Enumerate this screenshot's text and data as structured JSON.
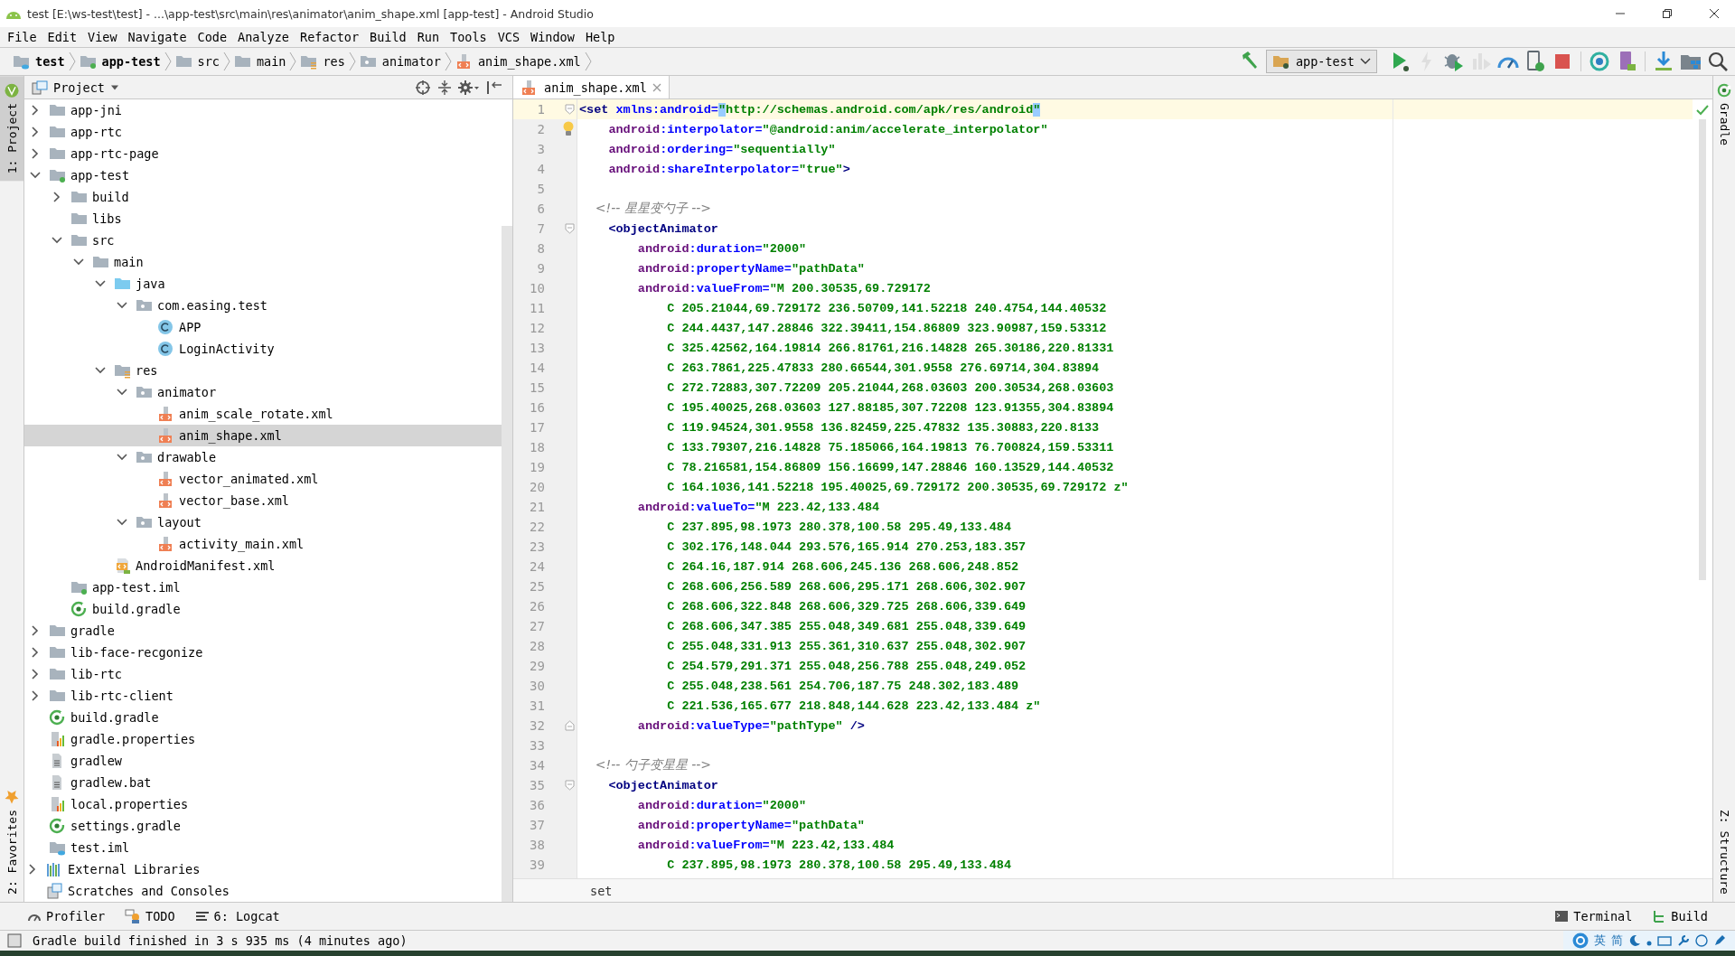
{
  "window": {
    "title": "test [E:\\ws-test\\test] - ...\\app-test\\src\\main\\res\\animator\\anim_shape.xml [app-test] - Android Studio"
  },
  "menu": [
    "File",
    "Edit",
    "View",
    "Navigate",
    "Code",
    "Analyze",
    "Refactor",
    "Build",
    "Run",
    "Tools",
    "VCS",
    "Window",
    "Help"
  ],
  "breadcrumbs": [
    {
      "kind": "project",
      "label": "test"
    },
    {
      "kind": "module",
      "label": "app-test"
    },
    {
      "kind": "folder",
      "label": "src"
    },
    {
      "kind": "folder",
      "label": "main"
    },
    {
      "kind": "res",
      "label": "res"
    },
    {
      "kind": "package",
      "label": "animator"
    },
    {
      "kind": "xml",
      "label": "anim_shape.xml"
    }
  ],
  "toolbar": [
    {
      "kind": "hammer",
      "disabled": false
    },
    {
      "kind": "run-config",
      "label": "app-test",
      "disabled": false
    },
    {
      "kind": "run",
      "disabled": false
    },
    {
      "kind": "lightning",
      "disabled": true
    },
    {
      "kind": "debug",
      "disabled": false
    },
    {
      "kind": "attach",
      "disabled": true
    },
    {
      "kind": "profile",
      "disabled": false
    },
    {
      "kind": "device-debug",
      "disabled": false
    },
    {
      "kind": "stop",
      "disabled": false
    },
    {
      "kind": "sync",
      "disabled": false
    },
    {
      "kind": "avd",
      "disabled": false
    },
    {
      "kind": "sdk",
      "disabled": false
    },
    {
      "kind": "structure",
      "disabled": false
    },
    {
      "kind": "search",
      "disabled": false
    }
  ],
  "left_stripe": {
    "top": [
      {
        "label": "1: Project",
        "selected": true
      }
    ],
    "bottom": [
      {
        "label": "2: Favorites",
        "selected": false
      }
    ]
  },
  "right_stripe": {
    "top": [
      {
        "label": "Gradle",
        "selected": false
      }
    ],
    "bottom": [
      {
        "label": "Z: Structure",
        "selected": false
      }
    ]
  },
  "project_panel": {
    "title": "Project",
    "tree": [
      {
        "children": [
          {
            "name": "app-jni",
            "kind": "folder",
            "expanded": false,
            "selected": false
          },
          {
            "name": "app-rtc",
            "kind": "folder",
            "expanded": false,
            "selected": false
          },
          {
            "name": "app-rtc-page",
            "kind": "folder",
            "expanded": false,
            "selected": false
          },
          {
            "name": "app-test",
            "kind": "module",
            "expanded": true,
            "selected": false,
            "children": [
              {
                "name": "build",
                "kind": "folder",
                "expanded": false,
                "selected": false
              },
              {
                "name": "libs",
                "kind": "folder",
                "selected": false
              },
              {
                "name": "src",
                "kind": "folder",
                "expanded": true,
                "selected": false,
                "children": [
                  {
                    "name": "main",
                    "kind": "folder",
                    "expanded": true,
                    "selected": false,
                    "children": [
                      {
                        "name": "java",
                        "kind": "source",
                        "expanded": true,
                        "selected": false,
                        "children": [
                          {
                            "name": "com.easing.test",
                            "kind": "package",
                            "expanded": true,
                            "selected": false,
                            "children": [
                              {
                                "name": "APP",
                                "kind": "class",
                                "selected": false
                              },
                              {
                                "name": "LoginActivity",
                                "kind": "class",
                                "selected": false
                              }
                            ]
                          }
                        ]
                      },
                      {
                        "name": "res",
                        "kind": "res",
                        "expanded": true,
                        "selected": false,
                        "children": [
                          {
                            "name": "animator",
                            "kind": "package",
                            "expanded": true,
                            "selected": false,
                            "children": [
                              {
                                "name": "anim_scale_rotate.xml",
                                "kind": "xml",
                                "selected": false
                              },
                              {
                                "name": "anim_shape.xml",
                                "kind": "xml",
                                "selected": true
                              }
                            ]
                          },
                          {
                            "name": "drawable",
                            "kind": "package",
                            "expanded": true,
                            "selected": false,
                            "children": [
                              {
                                "name": "vector_animated.xml",
                                "kind": "xml",
                                "selected": false
                              },
                              {
                                "name": "vector_base.xml",
                                "kind": "xml",
                                "selected": false
                              }
                            ]
                          },
                          {
                            "name": "layout",
                            "kind": "package",
                            "expanded": true,
                            "selected": false,
                            "children": [
                              {
                                "name": "activity_main.xml",
                                "kind": "xml",
                                "selected": false
                              }
                            ]
                          }
                        ]
                      },
                      {
                        "name": "AndroidManifest.xml",
                        "kind": "manifest",
                        "selected": false
                      }
                    ]
                  }
                ]
              },
              {
                "name": "app-test.iml",
                "kind": "module",
                "selected": false
              },
              {
                "name": "build.gradle",
                "kind": "gradle",
                "selected": false
              }
            ]
          },
          {
            "name": "gradle",
            "kind": "folder",
            "expanded": false,
            "selected": false
          },
          {
            "name": "lib-face-recgonize",
            "kind": "folder",
            "expanded": false,
            "selected": false
          },
          {
            "name": "lib-rtc",
            "kind": "folder",
            "expanded": false,
            "selected": false
          },
          {
            "name": "lib-rtc-client",
            "kind": "folder",
            "expanded": false,
            "selected": false
          },
          {
            "name": "build.gradle",
            "kind": "gradle",
            "selected": false
          },
          {
            "name": "gradle.properties",
            "kind": "properties",
            "selected": false
          },
          {
            "name": "gradlew",
            "kind": "text",
            "selected": false
          },
          {
            "name": "gradlew.bat",
            "kind": "text",
            "selected": false
          },
          {
            "name": "local.properties",
            "kind": "properties",
            "selected": false
          },
          {
            "name": "settings.gradle",
            "kind": "gradle",
            "selected": false
          },
          {
            "name": "test.iml",
            "kind": "project",
            "selected": false
          }
        ]
      },
      {
        "name": "External Libraries",
        "kind": "libraries",
        "expanded": false,
        "selected": false
      },
      {
        "name": "Scratches and Consoles",
        "kind": "scratches",
        "selected": false
      }
    ]
  },
  "editor": {
    "tab": {
      "label": "anim_shape.xml",
      "selected": true
    },
    "lines": [
      {
        "number": "1",
        "current": true,
        "kind": "fold-open",
        "tokens": [
          {
            "kind": "tag",
            "text": "<set"
          },
          {
            "kind": "attr",
            "text": " xmlns:android="
          },
          {
            "kind": "match",
            "text": "\""
          },
          {
            "kind": "val",
            "text": "http://schemas.android.com/apk/res/android"
          },
          {
            "kind": "match",
            "text": "\""
          }
        ]
      },
      {
        "number": "2",
        "current": false,
        "kind": "bulb",
        "tokens": [
          {
            "kind": "ns",
            "text": "    android"
          },
          {
            "kind": "attr",
            "text": ":interpolator="
          },
          {
            "kind": "val",
            "text": "\"@android:anim/accelerate_interpolator\""
          }
        ]
      },
      {
        "number": "3",
        "current": false,
        "tokens": [
          {
            "kind": "ns",
            "text": "    android"
          },
          {
            "kind": "attr",
            "text": ":ordering="
          },
          {
            "kind": "val",
            "text": "\"sequentially\""
          }
        ]
      },
      {
        "number": "4",
        "current": false,
        "tokens": [
          {
            "kind": "ns",
            "text": "    android"
          },
          {
            "kind": "attr",
            "text": ":shareInterpolator="
          },
          {
            "kind": "val",
            "text": "\"true\""
          },
          {
            "kind": "tag",
            "text": ">"
          }
        ]
      },
      {
        "number": "5",
        "current": false
      },
      {
        "number": "6",
        "current": false,
        "tokens": [
          {
            "kind": "comment",
            "text": "    <!-- 星星变勺子 -->"
          }
        ]
      },
      {
        "number": "7",
        "current": false,
        "kind": "fold-open",
        "tokens": [
          {
            "kind": "tag",
            "text": "    <objectAnimator"
          }
        ]
      },
      {
        "number": "8",
        "current": false,
        "tokens": [
          {
            "kind": "ns",
            "text": "        android"
          },
          {
            "kind": "attr",
            "text": ":duration="
          },
          {
            "kind": "val",
            "text": "\"2000\""
          }
        ]
      },
      {
        "number": "9",
        "current": false,
        "tokens": [
          {
            "kind": "ns",
            "text": "        android"
          },
          {
            "kind": "attr",
            "text": ":propertyName="
          },
          {
            "kind": "val",
            "text": "\"pathData\""
          }
        ]
      },
      {
        "number": "10",
        "current": false,
        "tokens": [
          {
            "kind": "ns",
            "text": "        android"
          },
          {
            "kind": "attr",
            "text": ":valueFrom="
          },
          {
            "kind": "val",
            "text": "\"M 200.30535,69.729172"
          }
        ]
      },
      {
        "number": "11",
        "current": false,
        "tokens": [
          {
            "kind": "val",
            "text": "            C 205.21044,69.729172 236.50709,141.52218 240.4754,144.40532"
          }
        ]
      },
      {
        "number": "12",
        "current": false,
        "tokens": [
          {
            "kind": "val",
            "text": "            C 244.4437,147.28846 322.39411,154.86809 323.90987,159.53312"
          }
        ]
      },
      {
        "number": "13",
        "current": false,
        "tokens": [
          {
            "kind": "val",
            "text": "            C 325.42562,164.19814 266.81761,216.14828 265.30186,220.81331"
          }
        ]
      },
      {
        "number": "14",
        "current": false,
        "tokens": [
          {
            "kind": "val",
            "text": "            C 263.7861,225.47833 280.66544,301.9558 276.69714,304.83894"
          }
        ]
      },
      {
        "number": "15",
        "current": false,
        "tokens": [
          {
            "kind": "val",
            "text": "            C 272.72883,307.72209 205.21044,268.03603 200.30534,268.03603"
          }
        ]
      },
      {
        "number": "16",
        "current": false,
        "tokens": [
          {
            "kind": "val",
            "text": "            C 195.40025,268.03603 127.88185,307.72208 123.91355,304.83894"
          }
        ]
      },
      {
        "number": "17",
        "current": false,
        "tokens": [
          {
            "kind": "val",
            "text": "            C 119.94524,301.9558 136.82459,225.47832 135.30883,220.8133"
          }
        ]
      },
      {
        "number": "18",
        "current": false,
        "tokens": [
          {
            "kind": "val",
            "text": "            C 133.79307,216.14828 75.185066,164.19813 76.700824,159.53311"
          }
        ]
      },
      {
        "number": "19",
        "current": false,
        "tokens": [
          {
            "kind": "val",
            "text": "            C 78.216581,154.86809 156.16699,147.28846 160.13529,144.40532"
          }
        ]
      },
      {
        "number": "20",
        "current": false,
        "tokens": [
          {
            "kind": "val",
            "text": "            C 164.1036,141.52218 195.40025,69.729172 200.30535,69.729172 z\""
          }
        ]
      },
      {
        "number": "21",
        "current": false,
        "tokens": [
          {
            "kind": "ns",
            "text": "        android"
          },
          {
            "kind": "attr",
            "text": ":valueTo="
          },
          {
            "kind": "val",
            "text": "\"M 223.42,133.484"
          }
        ]
      },
      {
        "number": "22",
        "current": false,
        "tokens": [
          {
            "kind": "val",
            "text": "            C 237.895,98.1973 280.378,100.58 295.49,133.484"
          }
        ]
      },
      {
        "number": "23",
        "current": false,
        "tokens": [
          {
            "kind": "val",
            "text": "            C 302.176,148.044 293.576,165.914 270.253,183.357"
          }
        ]
      },
      {
        "number": "24",
        "current": false,
        "tokens": [
          {
            "kind": "val",
            "text": "            C 264.16,187.914 268.606,245.136 268.606,248.852"
          }
        ]
      },
      {
        "number": "25",
        "current": false,
        "tokens": [
          {
            "kind": "val",
            "text": "            C 268.606,256.589 268.606,295.171 268.606,302.907"
          }
        ]
      },
      {
        "number": "26",
        "current": false,
        "tokens": [
          {
            "kind": "val",
            "text": "            C 268.606,322.848 268.606,329.725 268.606,339.649"
          }
        ]
      },
      {
        "number": "27",
        "current": false,
        "tokens": [
          {
            "kind": "val",
            "text": "            C 268.606,347.385 255.048,349.681 255.048,339.649"
          }
        ]
      },
      {
        "number": "28",
        "current": false,
        "tokens": [
          {
            "kind": "val",
            "text": "            C 255.048,331.913 255.361,310.637 255.048,302.907"
          }
        ]
      },
      {
        "number": "29",
        "current": false,
        "tokens": [
          {
            "kind": "val",
            "text": "            C 254.579,291.371 255.048,256.788 255.048,249.052"
          }
        ]
      },
      {
        "number": "30",
        "current": false,
        "tokens": [
          {
            "kind": "val",
            "text": "            C 255.048,238.561 254.706,187.75 248.302,183.489"
          }
        ]
      },
      {
        "number": "31",
        "current": false,
        "tokens": [
          {
            "kind": "val",
            "text": "            C 221.536,165.677 218.848,144.628 223.42,133.484 z\""
          }
        ]
      },
      {
        "number": "32",
        "current": false,
        "kind": "fold-close",
        "tokens": [
          {
            "kind": "ns",
            "text": "        android"
          },
          {
            "kind": "attr",
            "text": ":valueType="
          },
          {
            "kind": "val",
            "text": "\"pathType\""
          },
          {
            "kind": "tag",
            "text": " />"
          }
        ]
      },
      {
        "number": "33",
        "current": false
      },
      {
        "number": "34",
        "current": false,
        "tokens": [
          {
            "kind": "comment",
            "text": "    <!-- 勺子变星星 -->"
          }
        ]
      },
      {
        "number": "35",
        "current": false,
        "kind": "fold-open",
        "tokens": [
          {
            "kind": "tag",
            "text": "    <objectAnimator"
          }
        ]
      },
      {
        "number": "36",
        "current": false,
        "tokens": [
          {
            "kind": "ns",
            "text": "        android"
          },
          {
            "kind": "attr",
            "text": ":duration="
          },
          {
            "kind": "val",
            "text": "\"2000\""
          }
        ]
      },
      {
        "number": "37",
        "current": false,
        "tokens": [
          {
            "kind": "ns",
            "text": "        android"
          },
          {
            "kind": "attr",
            "text": ":propertyName="
          },
          {
            "kind": "val",
            "text": "\"pathData\""
          }
        ]
      },
      {
        "number": "38",
        "current": false,
        "tokens": [
          {
            "kind": "ns",
            "text": "        android"
          },
          {
            "kind": "attr",
            "text": ":valueFrom="
          },
          {
            "kind": "val",
            "text": "\"M 223.42,133.484"
          }
        ]
      },
      {
        "number": "39",
        "current": false,
        "tokens": [
          {
            "kind": "val",
            "text": "            C 237.895,98.1973 280.378,100.58 295.49,133.484"
          }
        ]
      }
    ],
    "breadcrumb": "set"
  },
  "tool_windows": {
    "left": [
      {
        "kind": "profiler",
        "label": "Profiler"
      },
      {
        "kind": "todo",
        "label": "TODO"
      },
      {
        "kind": "logcat",
        "label": "6: Logcat"
      }
    ],
    "right": [
      {
        "kind": "terminal",
        "label": "Terminal"
      },
      {
        "kind": "build",
        "label": "Build"
      }
    ]
  },
  "status_bar": {
    "message": "Gradle build finished in 3 s 935 ms (4 minutes ago)"
  },
  "ime_toolbar": {
    "items": [
      "英",
      "简"
    ]
  }
}
